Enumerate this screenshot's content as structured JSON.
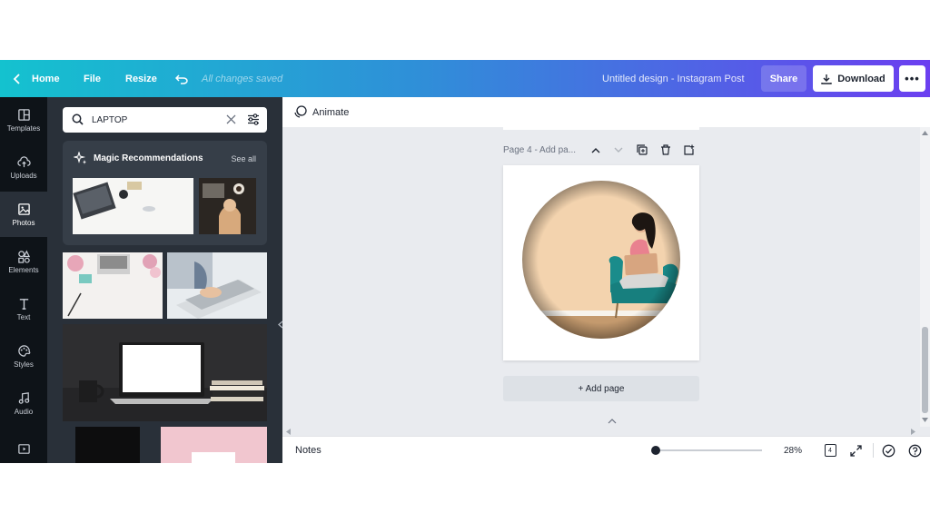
{
  "topbar": {
    "home_label": "Home",
    "file_label": "File",
    "resize_label": "Resize",
    "save_status": "All changes saved",
    "design_title": "Untitled design - Instagram Post",
    "share_label": "Share",
    "download_label": "Download",
    "more_label": "•••"
  },
  "rail": {
    "items": [
      {
        "label": "Templates",
        "icon": "templates-icon"
      },
      {
        "label": "Uploads",
        "icon": "upload-cloud-icon"
      },
      {
        "label": "Photos",
        "icon": "image-icon"
      },
      {
        "label": "Elements",
        "icon": "shapes-icon"
      },
      {
        "label": "Text",
        "icon": "text-icon"
      },
      {
        "label": "Styles",
        "icon": "palette-icon"
      },
      {
        "label": "Audio",
        "icon": "music-note-icon"
      },
      {
        "label": "Videos",
        "icon": "video-icon"
      }
    ],
    "active": "Photos"
  },
  "panel": {
    "search_value": "LAPTOP",
    "magic_title": "Magic Recommendations",
    "see_all": "See all"
  },
  "editor": {
    "animate_label": "Animate",
    "page_label": "Page 4 - Add pa...",
    "add_page_label": "+ Add page"
  },
  "bottombar": {
    "notes_label": "Notes",
    "zoom_percent": "28%",
    "zoom_level": 0.28,
    "page_count": "4"
  },
  "colors": {
    "gradient_start": "#14c2cf",
    "gradient_end": "#6b3ff0",
    "sidebar_bg": "#0e1318",
    "panel_bg": "#293039",
    "canvas_bg": "#e9ebef"
  }
}
